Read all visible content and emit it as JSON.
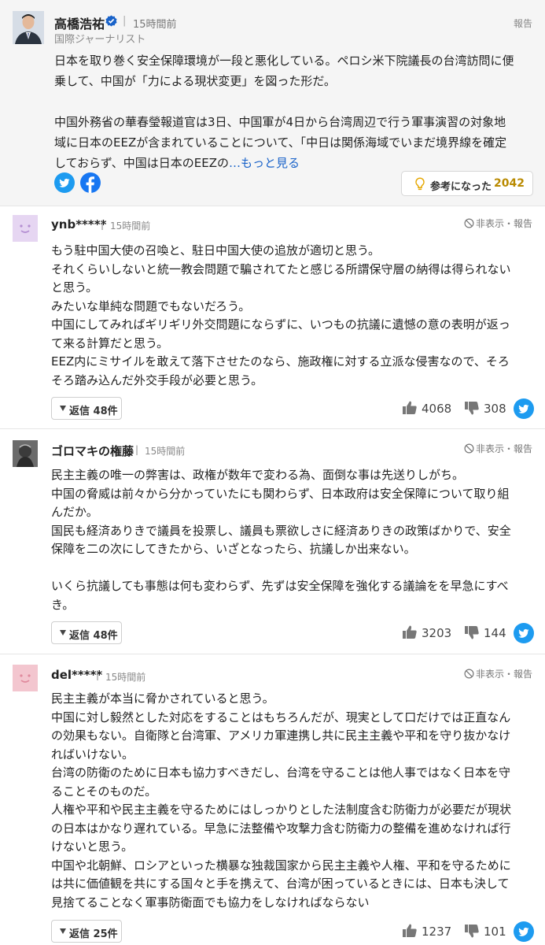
{
  "expert": {
    "name": "高橋浩祐",
    "time": "15時間前",
    "role": "国際ジャーナリスト",
    "report": "報告",
    "lines": [
      "日本を取り巻く安全保障環境が一段と悪化している。ペロシ米下院議長の台湾訪問に便",
      "乗して、中国が「力による現状変更」を図った形だ。",
      "",
      "中国外務省の華春瑩報道官は3日、中国軍が4日から台湾周辺で行う軍事演習の対象地",
      "域に日本のEEZが含まれていることについて、「中日は関係海域でいまだ境界線を確定",
      "しておらず、中国は日本のEEZの"
    ],
    "more": "…もっと見る",
    "useful_label": "参考になった",
    "useful_count": "2042"
  },
  "comments": [
    {
      "user": "ynb*****",
      "time": "15時間前",
      "hide": "非表示・報告",
      "lines": [
        "もう駐中国大使の召喚と、駐日中国大使の追放が適切と思う。",
        "それくらいしないと統一教会問題で騙されてたと感じる所謂保守層の納得は得られない",
        "と思う。",
        "みたいな単純な問題でもないだろう。",
        "中国にしてみればギリギリ外交問題にならずに、いつもの抗議に遺憾の意の表明が返っ",
        "て来る計算だと思う。",
        "EEZ内にミサイルを敢えて落下させたのなら、施政権に対する立派な侵害なので、そろ",
        "そろ踏み込んだ外交手段が必要と思う。"
      ],
      "replies": "返信 48件",
      "likes": "4068",
      "dislikes": "308"
    },
    {
      "user": "ゴロマキの権藤",
      "time": "15時間前",
      "hide": "非表示・報告",
      "lines": [
        "民主主義の唯一の弊害は、政権が数年で変わる為、面倒な事は先送りしがち。",
        "中国の脅威は前々から分かっていたにも関わらず、日本政府は安全保障について取り組",
        "んだか。",
        "国民も経済ありきで議員を投票し、議員も票欲しさに経済ありきの政策ばかりで、安全",
        "保障を二の次にしてきたから、いざとなったら、抗議しか出来ない。",
        "",
        "いくら抗議しても事態は何も変わらず、先ずは安全保障を強化する議論をを早急にすべ",
        "き。"
      ],
      "replies": "返信 48件",
      "likes": "3203",
      "dislikes": "144"
    },
    {
      "user": "del*****",
      "time": "15時間前",
      "hide": "非表示・報告",
      "lines": [
        "民主主義が本当に脅かされていると思う。",
        "中国に対し毅然とした対応をすることはもちろんだが、現実として口だけでは正直なん",
        "の効果もない。自衛隊と台湾軍、アメリカ軍連携し共に民主主義や平和を守り抜かなけ",
        "ればいけない。",
        "台湾の防衛のために日本も協力すべきだし、台湾を守ることは他人事ではなく日本を守",
        "ることそのものだ。",
        "人権や平和や民主主義を守るためにはしっかりとした法制度含む防衛力が必要だが現状",
        "の日本はかなり遅れている。早急に法整備や攻撃力含む防衛力の整備を進めなければ行",
        "けないと思う。",
        "中国や北朝鮮、ロシアといった横暴な独裁国家から民主主義や人権、平和を守るために",
        "は共に価値観を共にする国々と手を携えて、台湾が困っているときには、日本も決して",
        "見捨てることなく軍事防衛面でも協力をしなければならない"
      ],
      "replies": "返信 25件",
      "likes": "1237",
      "dislikes": "101"
    }
  ],
  "colors": {
    "link": "#1a63c9",
    "twitter": "#1d9bf0",
    "facebook": "#1877f2",
    "useful_count": "#b98a00",
    "avatar_pink": "#f3c6cf",
    "avatar_lavender": "#e6d6f2"
  },
  "icons": [
    "verified-badge-icon",
    "twitter-icon",
    "facebook-icon",
    "bulb-icon",
    "hide-icon",
    "thumbs-up-icon",
    "thumbs-down-icon",
    "caret-down-icon"
  ]
}
